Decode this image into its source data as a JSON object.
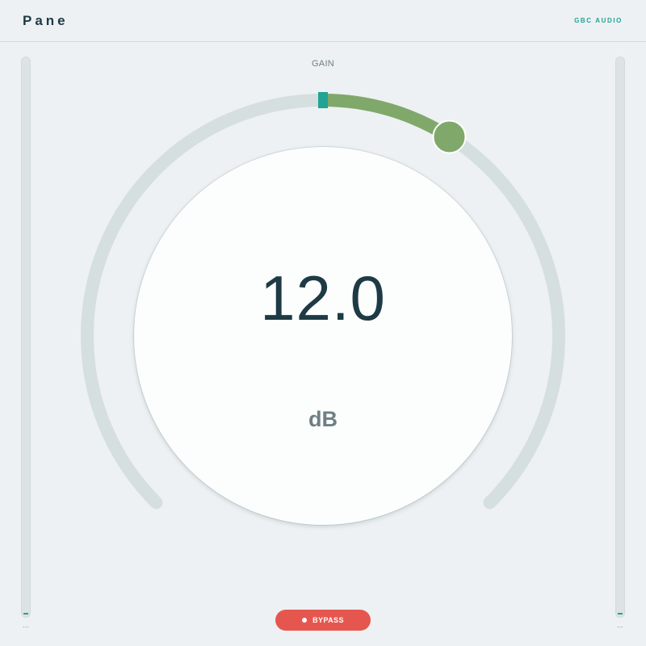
{
  "header": {
    "title": "Pane",
    "brand": "GBC AUDIO"
  },
  "meters": {
    "left": {
      "readout": "...",
      "level": 0.0
    },
    "right": {
      "readout": "...",
      "level": 0.0
    }
  },
  "knob": {
    "label": "GAIN",
    "value": "12.0",
    "unit": "dB",
    "position": 0.62
  },
  "bypass": {
    "label": "BYPASS"
  },
  "colors": {
    "accent": "#22a393",
    "arc_fill": "#80a86a",
    "arc_track": "#d6dfe0",
    "bypass": "#e5574e",
    "text_dark": "#1e3a44"
  }
}
